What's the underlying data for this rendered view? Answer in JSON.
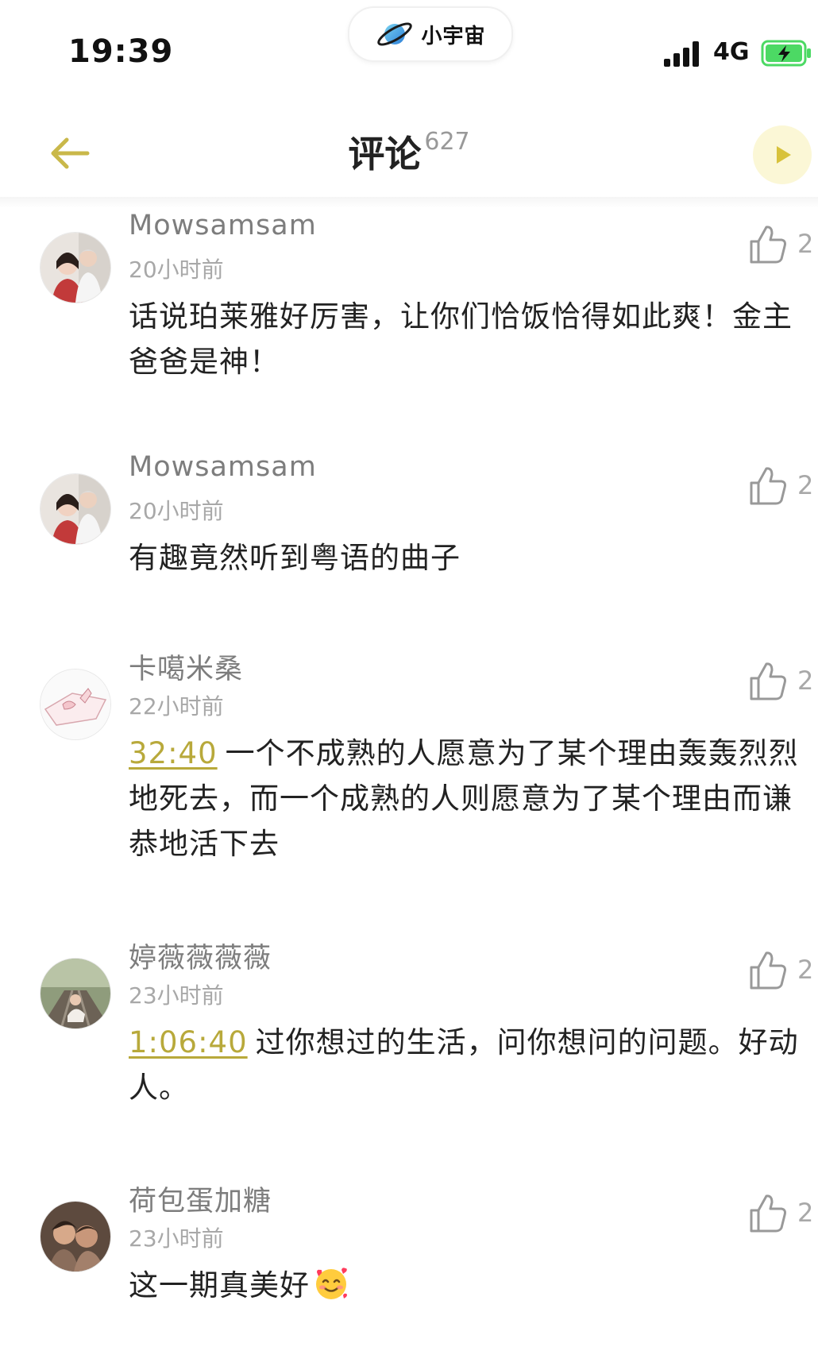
{
  "status_bar": {
    "time": "19:39",
    "app_badge": "小宇宙",
    "network": "4G",
    "icons": [
      "planet-icon",
      "signal-bars-icon",
      "battery-charging-icon"
    ]
  },
  "header": {
    "title": "评论",
    "count": "627",
    "icons": [
      "back-arrow-icon",
      "play-icon"
    ]
  },
  "colors": {
    "accent_yellow": "#b8a93b",
    "play_bg": "#fbf7d6",
    "battery_green": "#4cd964",
    "muted_text": "#a8a8a8",
    "name_text": "#7d7d7d"
  },
  "comments": [
    {
      "username": "Mowsamsam",
      "time": "20小时前",
      "likes": "2",
      "timestamp_link": "",
      "text": "话说珀莱雅好厉害，让你们恰饭恰得如此爽！金主爸爸是神！"
    },
    {
      "username": "Mowsamsam",
      "time": "20小时前",
      "likes": "2",
      "timestamp_link": "",
      "text": "有趣竟然听到粤语的曲子"
    },
    {
      "username": "卡噶米桑",
      "time": "22小时前",
      "likes": "2",
      "timestamp_link": "32:40",
      "text": "一个不成熟的人愿意为了某个理由轰轰烈烈地死去，而一个成熟的人则愿意为了某个理由而谦恭地活下去"
    },
    {
      "username": "婷薇薇薇薇",
      "time": "23小时前",
      "likes": "2",
      "timestamp_link": "1:06:40",
      "text": "过你想过的生活，问你想问的问题。好动人。"
    },
    {
      "username": "荷包蛋加糖",
      "time": "23小时前",
      "likes": "2",
      "timestamp_link": "",
      "text": "这一期真美好",
      "emoji": "smiling-face-with-hearts-icon"
    }
  ]
}
